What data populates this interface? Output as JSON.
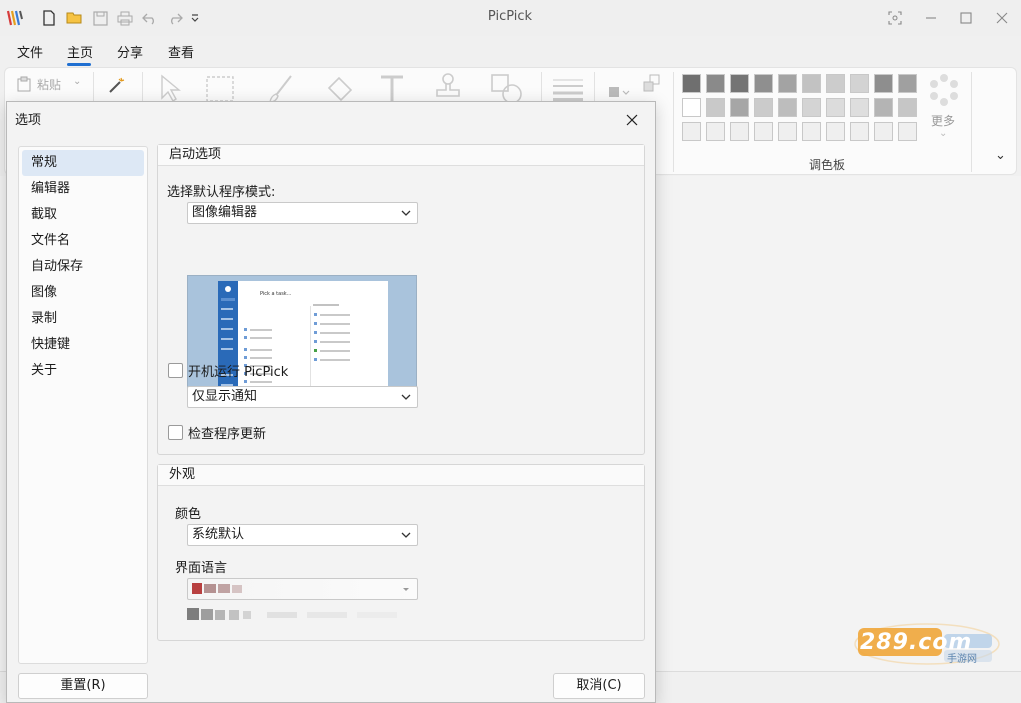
{
  "app": {
    "title": "PicPick",
    "menu_tabs": [
      "文件",
      "主页",
      "分享",
      "查看"
    ],
    "active_tab": "主页"
  },
  "ribbon": {
    "paste_label": "粘贴",
    "more_label": "更多",
    "palette_label": "调色板",
    "palette_colors": [
      [
        "#6f6f6f",
        "#8a8a8a",
        "#747474",
        "#8f8f8f",
        "#a3a3a3",
        "#c2c2c2",
        "#cccccc",
        "#d3d3d3",
        "#8e8e8e",
        "#a0a0a0"
      ],
      [
        "#ffffff",
        "#c9c9c9",
        "#a6a6a6",
        "#cbcbcb",
        "#bdbdbd",
        "#d4d4d4",
        "#dcdcdc",
        "#dedede",
        "#b4b4b4",
        "#c6c6c6"
      ],
      [
        "#efefef",
        "#efefef",
        "#efefef",
        "#efefef",
        "#efefef",
        "#efefef",
        "#efefef",
        "#efefef",
        "#efefef",
        "#efefef"
      ]
    ]
  },
  "dialog": {
    "title": "选项",
    "nav_items": [
      "常规",
      "编辑器",
      "截取",
      "文件名",
      "自动保存",
      "图像",
      "录制",
      "快捷键",
      "关于"
    ],
    "selected_nav": "常规",
    "startup": {
      "header": "启动选项",
      "mode_label": "选择默认程序模式:",
      "mode_value": "图像编辑器",
      "preview_title": "Pick a task...",
      "run_at_startup_label": "开机运行 PicPick",
      "run_at_startup_checked": false,
      "notify_value": "仅显示通知",
      "check_updates_label": "检查程序更新",
      "check_updates_checked": false
    },
    "appearance": {
      "header": "外观",
      "color_label": "颜色",
      "color_value": "系统默认",
      "language_label": "界面语言"
    },
    "reset_button": "重置(R)",
    "cancel_button": "取消(C)"
  },
  "watermark": {
    "brand": "289.com",
    "sub": "手游网"
  }
}
